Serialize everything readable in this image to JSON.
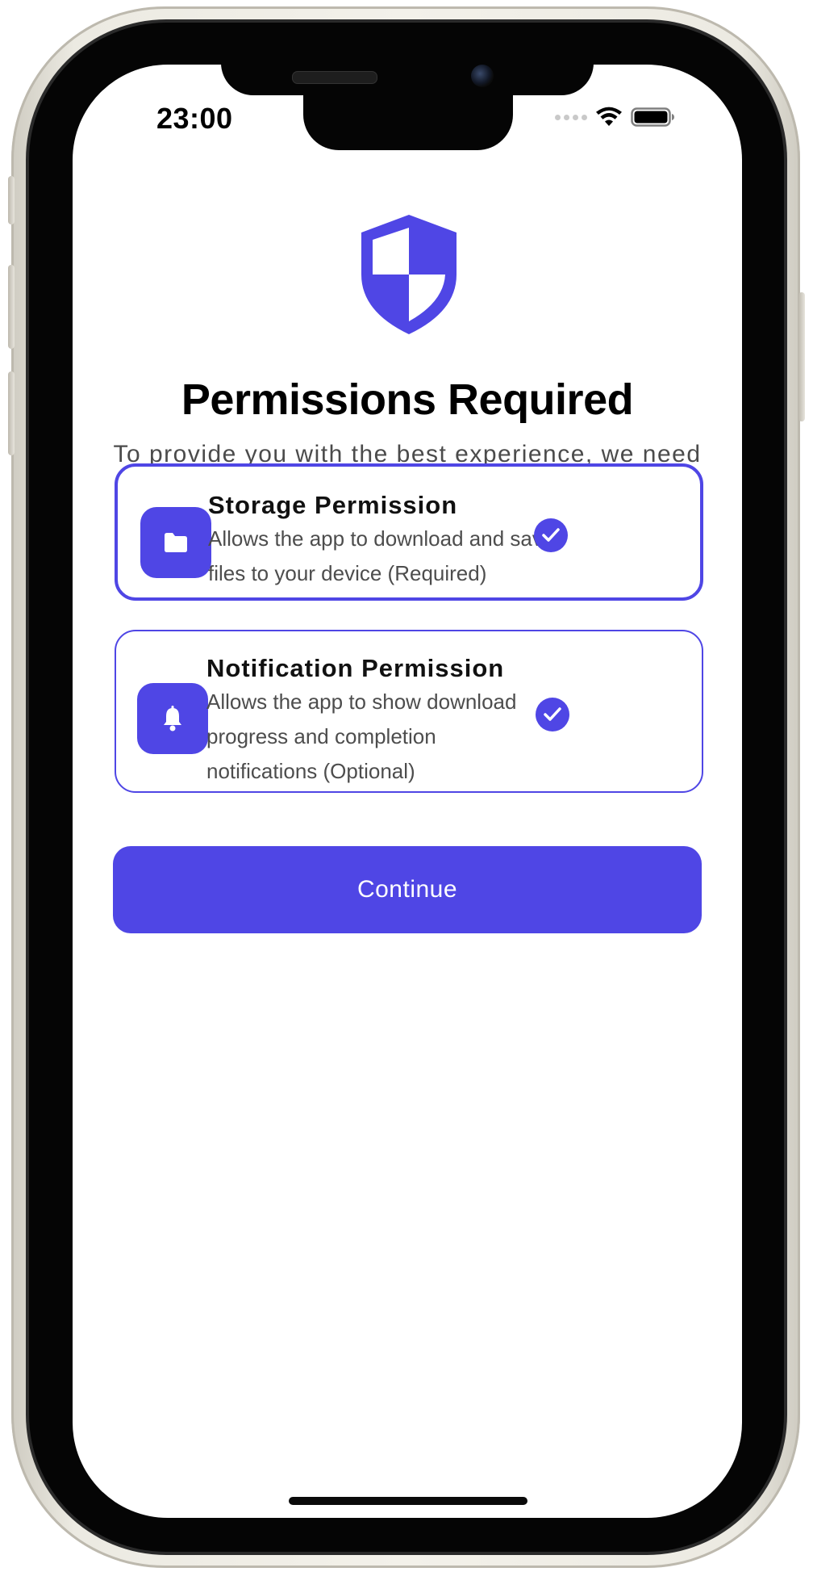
{
  "status_bar": {
    "time": "23:00"
  },
  "header": {
    "icon": "shield-icon",
    "title": "Permissions Required",
    "subtitle": "To provide you with the best experience, we need access to storage and notifications."
  },
  "permissions": [
    {
      "icon": "folder-icon",
      "title": "Storage Permission",
      "description": "Allows the app to download and save files to your device (Required)",
      "granted": true
    },
    {
      "icon": "bell-icon",
      "title": "Notification Permission",
      "description": "Allows the app to show download progress and completion notifications (Optional)",
      "granted": true
    }
  ],
  "actions": {
    "continue_label": "Continue"
  },
  "colors": {
    "accent": "#4f46e5",
    "text_primary": "#000000",
    "text_secondary": "#4b4b4b"
  }
}
